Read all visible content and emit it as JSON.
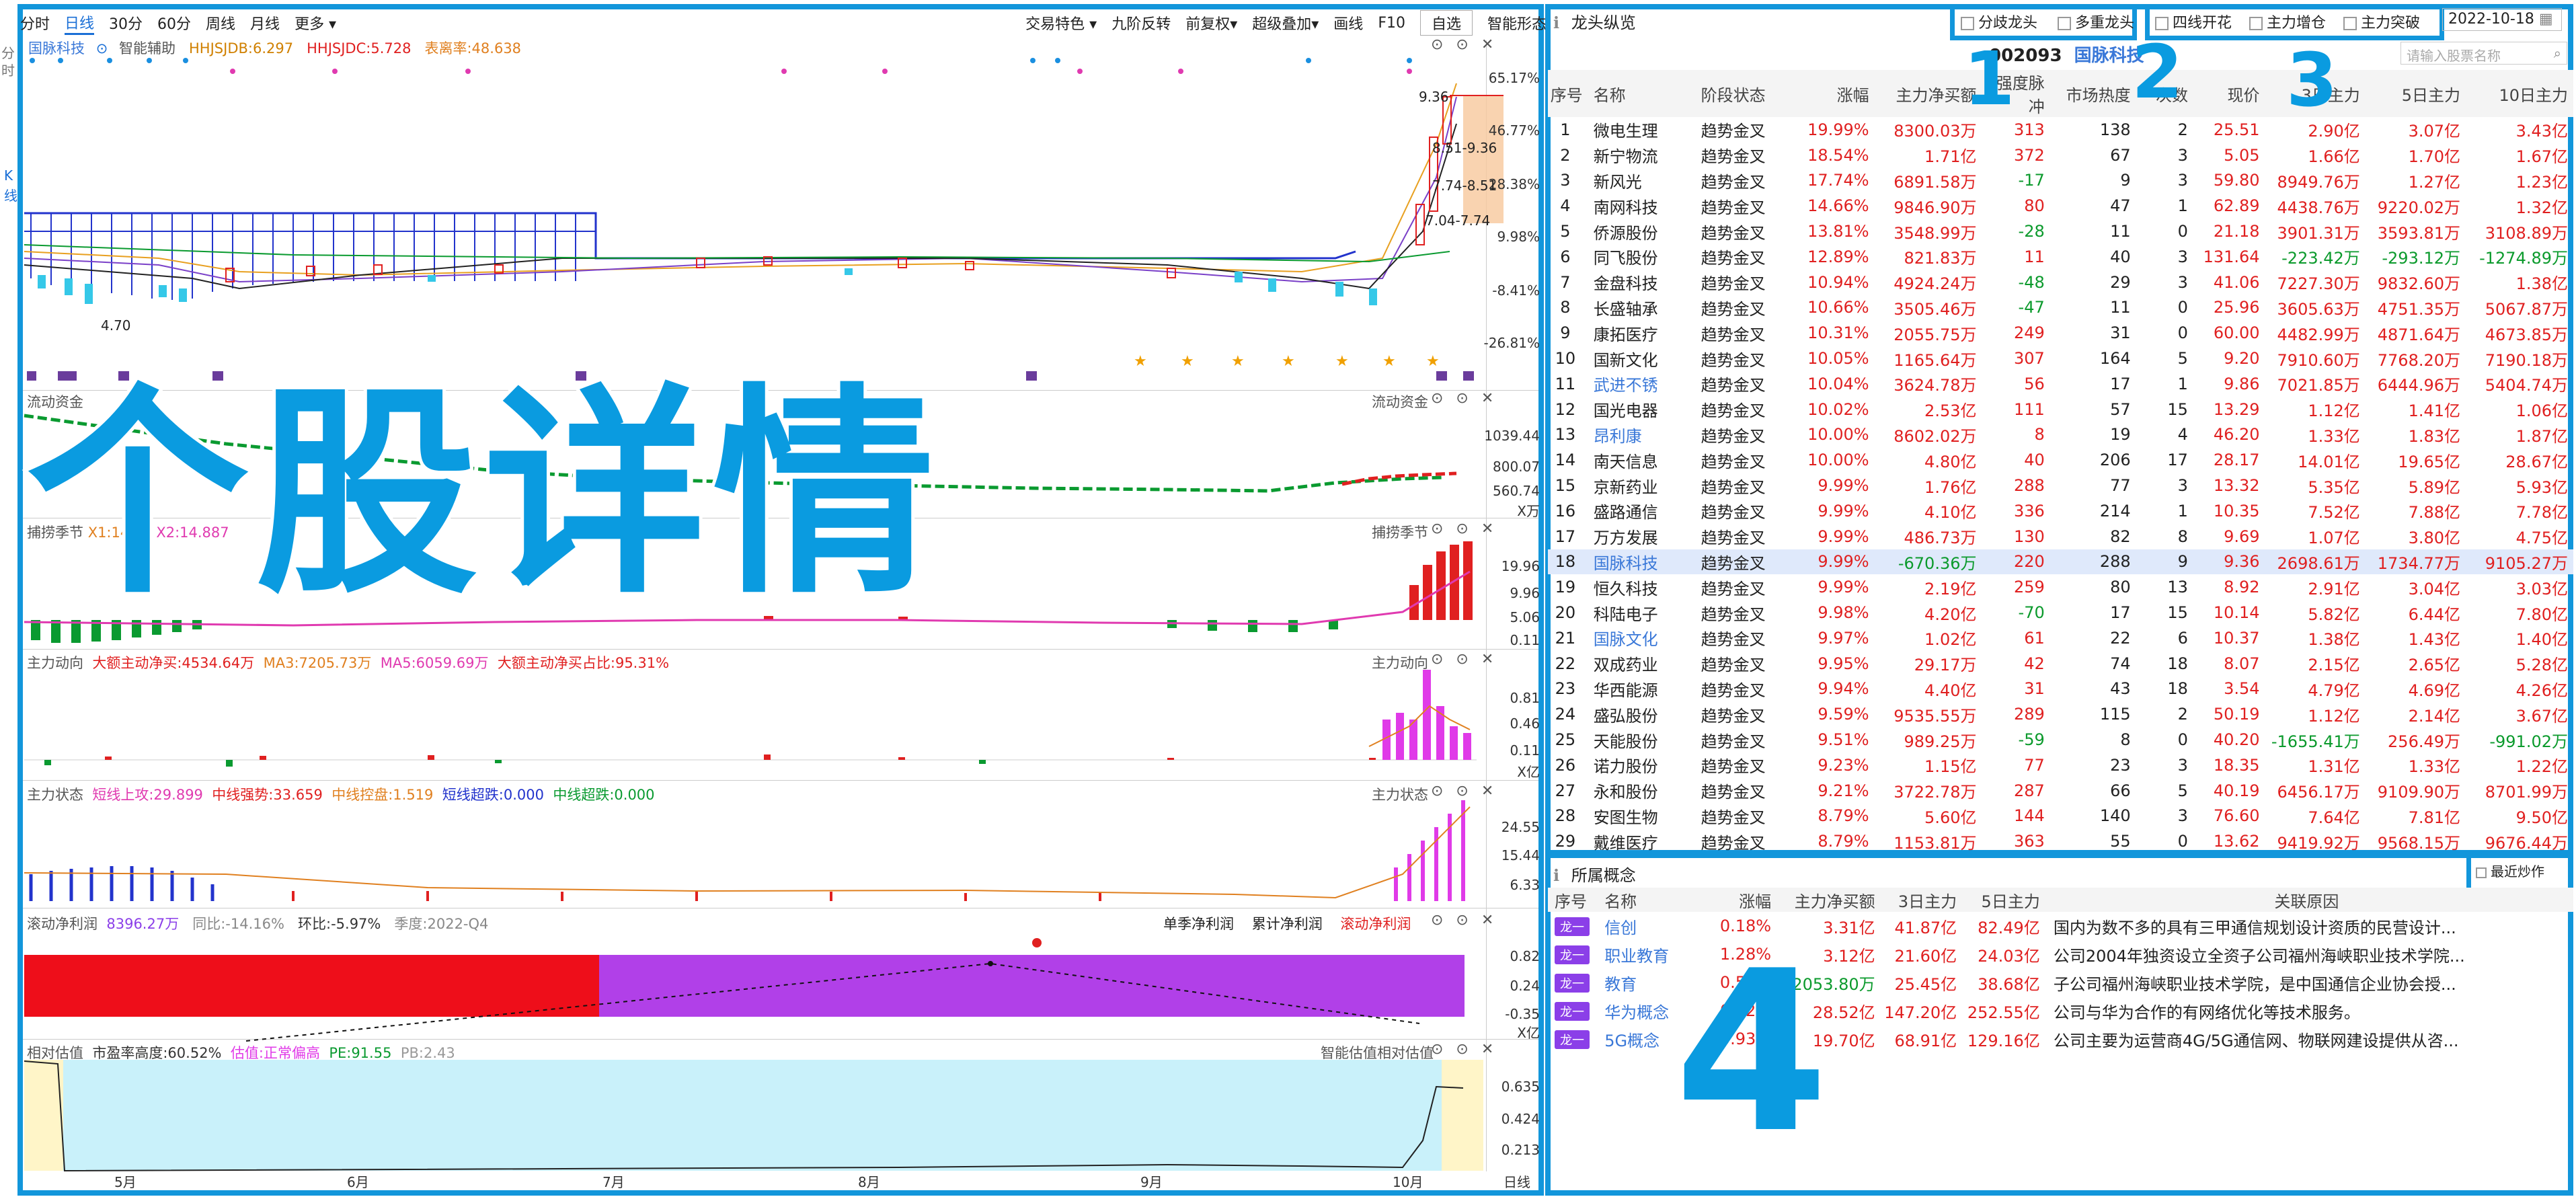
{
  "toolbar": {
    "items": [
      "分时",
      "日线",
      "30分",
      "60分",
      "周线",
      "月线",
      "更多 ▾",
      "交易特色 ▾",
      "九阶反转",
      "前复权▾",
      "超级叠加▾",
      "画线",
      "F10",
      "自选",
      "智能形态"
    ],
    "left_tabs": [
      "分",
      "时",
      "K",
      "线"
    ]
  },
  "kline": {
    "stock_name": "国脉科技",
    "legend": [
      "智能辅助",
      "HHJSJDB:6.297",
      "HHJSJDC:5.728",
      "表离率:48.638"
    ],
    "right_axis": [
      "65.17%",
      "46.77%",
      "28.38%",
      "9.98%",
      "-8.41%",
      "-26.81%"
    ],
    "price_labels": [
      "9.36",
      "8.51-9.36",
      "7.74-8.51",
      "7.04-7.74",
      "4.70"
    ]
  },
  "flow": {
    "title": "流动资金",
    "title_r": "流动资金",
    "axis": [
      "1039.44",
      "800.07",
      "560.74",
      "X万"
    ]
  },
  "catch": {
    "title": "捕捞季节",
    "legend": "X1:14.41",
    "legend2": "X2:14.887",
    "axis": [
      "19.96",
      "9.96",
      "5.06",
      "0.11"
    ]
  },
  "main_dir": {
    "title": "主力动向",
    "legend": [
      "大额主动净买:4534.64万",
      "MA3:7205.73万",
      "MA5:6059.69万",
      "大额主动净买占比:95.31%"
    ],
    "axis": [
      "0.81",
      "0.46",
      "0.11",
      "X亿"
    ]
  },
  "main_state": {
    "title": "主力状态",
    "legend": [
      "短线上攻:29.899",
      "中线强势:33.659",
      "中线控盘:1.519",
      "短线超跌:0.000",
      "中线超跌:0.000"
    ],
    "axis": [
      "24.55",
      "15.44",
      "6.33"
    ]
  },
  "profit": {
    "title": "滚动净利润",
    "value": "8396.27万",
    "yoy": "同比:-14.16%",
    "qoq": "环比:-5.97%",
    "season": "季度:2022-Q4",
    "tabs": [
      "单季净利润",
      "累计净利润",
      "滚动净利润"
    ],
    "axis": [
      "0.82",
      "0.24",
      "-0.35",
      "X亿"
    ]
  },
  "valuation": {
    "title": "相对估值",
    "legend": [
      "市盈率高度:60.52%",
      "估值:正常偏高",
      "PE:91.55",
      "PB:2.43"
    ],
    "title_r": "智能估值相对估值",
    "axis": [
      "0.635",
      "0.424",
      "0.213"
    ]
  },
  "x_axis": {
    "months": [
      "5月",
      "6月",
      "7月",
      "8月",
      "9月",
      "10月"
    ],
    "end_label": "日线"
  },
  "overlay": {
    "big_text": "个股详情",
    "numbers": [
      "1",
      "2",
      "3",
      "4"
    ]
  },
  "ranking": {
    "title": "龙头纵览",
    "filters": [
      "分歧龙头",
      "多重龙头",
      "四线开花",
      "主力增仓",
      "主力突破"
    ],
    "date": "2022-10-18",
    "code": "002093",
    "name": "国脉科技",
    "search_placeholder": "请输入股票名称",
    "headers": [
      "序号",
      "名称",
      "阶段状态",
      "涨幅",
      "主力净买额",
      "强度脉冲",
      "市场热度",
      "次数",
      "现价",
      "3日主力",
      "5日主力",
      "10日主力"
    ],
    "rows": [
      [
        "1",
        "微电生理",
        "趋势金叉",
        "19.99%",
        "8300.03万",
        "313",
        "138",
        "2",
        "25.51",
        "2.90亿",
        "3.07亿",
        "3.43亿"
      ],
      [
        "2",
        "新宁物流",
        "趋势金叉",
        "18.54%",
        "1.71亿",
        "372",
        "67",
        "3",
        "5.05",
        "1.66亿",
        "1.70亿",
        "1.67亿"
      ],
      [
        "3",
        "新风光",
        "趋势金叉",
        "17.74%",
        "6891.58万",
        "-17",
        "9",
        "3",
        "59.80",
        "8949.76万",
        "1.27亿",
        "1.23亿"
      ],
      [
        "4",
        "南网科技",
        "趋势金叉",
        "14.66%",
        "9846.90万",
        "80",
        "47",
        "1",
        "62.89",
        "4438.76万",
        "9220.02万",
        "1.32亿"
      ],
      [
        "5",
        "侨源股份",
        "趋势金叉",
        "13.81%",
        "3548.99万",
        "-28",
        "11",
        "0",
        "21.18",
        "3901.31万",
        "3593.81万",
        "3108.89万"
      ],
      [
        "6",
        "同飞股份",
        "趋势金叉",
        "12.89%",
        "821.83万",
        "11",
        "40",
        "3",
        "131.64",
        "-223.42万",
        "-293.12万",
        "-1274.89万"
      ],
      [
        "7",
        "金盘科技",
        "趋势金叉",
        "10.94%",
        "4924.24万",
        "-48",
        "29",
        "3",
        "41.06",
        "7227.30万",
        "9832.60万",
        "1.38亿"
      ],
      [
        "8",
        "长盛轴承",
        "趋势金叉",
        "10.66%",
        "3505.46万",
        "-47",
        "11",
        "0",
        "25.96",
        "3605.63万",
        "4751.35万",
        "5067.87万"
      ],
      [
        "9",
        "康拓医疗",
        "趋势金叉",
        "10.31%",
        "2055.75万",
        "249",
        "31",
        "0",
        "60.00",
        "4482.99万",
        "4871.64万",
        "4673.85万"
      ],
      [
        "10",
        "国新文化",
        "趋势金叉",
        "10.05%",
        "1165.64万",
        "307",
        "164",
        "5",
        "9.20",
        "7910.60万",
        "7768.20万",
        "7190.18万"
      ],
      [
        "11",
        "武进不锈",
        "趋势金叉",
        "10.04%",
        "3624.78万",
        "56",
        "17",
        "1",
        "9.86",
        "7021.85万",
        "6444.96万",
        "5404.74万"
      ],
      [
        "12",
        "国光电器",
        "趋势金叉",
        "10.02%",
        "2.53亿",
        "111",
        "57",
        "15",
        "13.29",
        "1.12亿",
        "1.41亿",
        "1.06亿"
      ],
      [
        "13",
        "昂利康",
        "趋势金叉",
        "10.00%",
        "8602.02万",
        "8",
        "19",
        "4",
        "46.20",
        "1.33亿",
        "1.83亿",
        "1.87亿"
      ],
      [
        "14",
        "南天信息",
        "趋势金叉",
        "10.00%",
        "4.80亿",
        "40",
        "206",
        "17",
        "28.17",
        "14.01亿",
        "19.65亿",
        "28.67亿"
      ],
      [
        "15",
        "京新药业",
        "趋势金叉",
        "9.99%",
        "1.76亿",
        "288",
        "77",
        "3",
        "13.32",
        "5.35亿",
        "5.89亿",
        "5.93亿"
      ],
      [
        "16",
        "盛路通信",
        "趋势金叉",
        "9.99%",
        "4.10亿",
        "336",
        "214",
        "1",
        "10.35",
        "7.52亿",
        "7.88亿",
        "7.78亿"
      ],
      [
        "17",
        "万方发展",
        "趋势金叉",
        "9.99%",
        "486.73万",
        "130",
        "82",
        "8",
        "9.69",
        "1.07亿",
        "3.80亿",
        "4.75亿"
      ],
      [
        "18",
        "国脉科技",
        "趋势金叉",
        "9.99%",
        "-670.36万",
        "220",
        "288",
        "9",
        "9.36",
        "2698.61万",
        "1734.77万",
        "9105.27万"
      ],
      [
        "19",
        "恒久科技",
        "趋势金叉",
        "9.99%",
        "2.19亿",
        "259",
        "80",
        "13",
        "8.92",
        "2.91亿",
        "3.04亿",
        "3.03亿"
      ],
      [
        "20",
        "科陆电子",
        "趋势金叉",
        "9.98%",
        "4.20亿",
        "-70",
        "17",
        "15",
        "10.14",
        "5.82亿",
        "6.44亿",
        "7.80亿"
      ],
      [
        "21",
        "国脉文化",
        "趋势金叉",
        "9.97%",
        "1.02亿",
        "61",
        "22",
        "6",
        "10.37",
        "1.38亿",
        "1.43亿",
        "1.40亿"
      ],
      [
        "22",
        "双成药业",
        "趋势金叉",
        "9.95%",
        "29.17万",
        "42",
        "74",
        "18",
        "8.07",
        "2.15亿",
        "2.65亿",
        "5.28亿"
      ],
      [
        "23",
        "华西能源",
        "趋势金叉",
        "9.94%",
        "4.40亿",
        "31",
        "43",
        "18",
        "3.54",
        "4.79亿",
        "4.69亿",
        "4.26亿"
      ],
      [
        "24",
        "盛弘股份",
        "趋势金叉",
        "9.59%",
        "9535.55万",
        "289",
        "115",
        "2",
        "50.19",
        "1.12亿",
        "2.14亿",
        "3.67亿"
      ],
      [
        "25",
        "天能股份",
        "趋势金叉",
        "9.51%",
        "989.25万",
        "-59",
        "8",
        "0",
        "40.20",
        "-1655.41万",
        "256.49万",
        "-991.02万"
      ],
      [
        "26",
        "诺力股份",
        "趋势金叉",
        "9.23%",
        "1.15亿",
        "77",
        "23",
        "3",
        "18.35",
        "1.31亿",
        "1.33亿",
        "1.22亿"
      ],
      [
        "27",
        "永和股份",
        "趋势金叉",
        "9.21%",
        "3722.78万",
        "287",
        "66",
        "5",
        "40.19",
        "6456.17万",
        "9109.90万",
        "8701.99万"
      ],
      [
        "28",
        "安图生物",
        "趋势金叉",
        "8.79%",
        "5.60亿",
        "144",
        "140",
        "3",
        "76.60",
        "7.64亿",
        "7.81亿",
        "9.50亿"
      ],
      [
        "29",
        "戴维医疗",
        "趋势金叉",
        "8.79%",
        "1153.81万",
        "363",
        "55",
        "0",
        "13.62",
        "9419.92万",
        "9568.15万",
        "9676.44万"
      ]
    ]
  },
  "concepts": {
    "title": "所属概念",
    "recent_label": "最近炒作",
    "headers": [
      "序号",
      "名称",
      "涨幅",
      "主力净买额",
      "3日主力",
      "5日主力",
      "关联原因"
    ],
    "rows": [
      [
        "龙一",
        "信创",
        "0.18%",
        "3.31亿",
        "41.87亿",
        "82.49亿",
        "国内为数不多的具有三甲通信规划设计资质的民营设计..."
      ],
      [
        "龙一",
        "职业教育",
        "1.28%",
        "3.12亿",
        "21.60亿",
        "24.03亿",
        "公司2004年独资设立全资子公司福州海峡职业技术学院..."
      ],
      [
        "龙一",
        "教育",
        "0.55%",
        "-2053.80万",
        "25.45亿",
        "38.68亿",
        "子公司福州海峡职业技术学院，是中国通信企业协会授..."
      ],
      [
        "龙一",
        "华为概念",
        "0.62%",
        "28.52亿",
        "147.20亿",
        "252.55亿",
        "公司与华为合作的有网络优化等技术服务。"
      ],
      [
        "龙一",
        "5G概念",
        "0.93%",
        "19.70亿",
        "68.91亿",
        "129.16亿",
        "公司主要为运营商4G/5G通信网、物联网建设提供从咨..."
      ]
    ]
  }
}
